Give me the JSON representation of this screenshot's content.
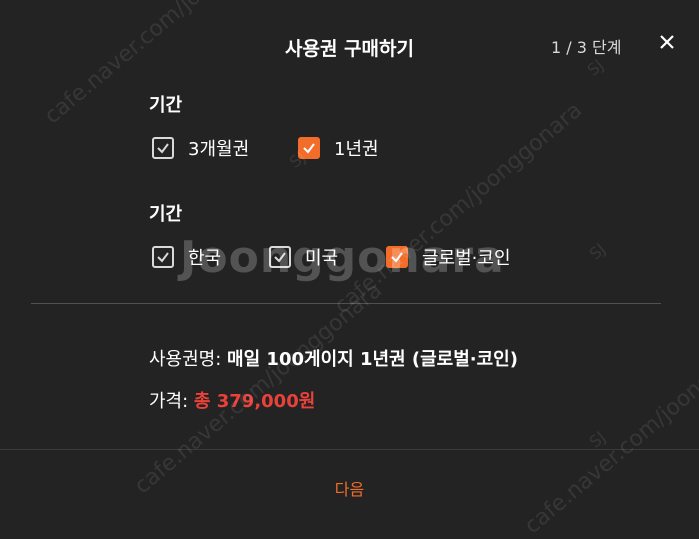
{
  "modal": {
    "title": "사용권 구매하기",
    "step": "1 / 3 단계",
    "close_icon": "close-icon"
  },
  "period": {
    "label": "기간",
    "options": [
      {
        "label": "3개월권",
        "checked": false
      },
      {
        "label": "1년권",
        "checked": true
      }
    ]
  },
  "region": {
    "label": "기간",
    "options": [
      {
        "label": "한국",
        "checked": false
      },
      {
        "label": "미국",
        "checked": false
      },
      {
        "label": "글로벌·코인",
        "checked": true
      }
    ]
  },
  "summary": {
    "name_key": "사용권명:",
    "name_value": "매일 100게이지 1년권 (글로벌·코인)",
    "price_key": "가격:",
    "price_value": "총 379,000원"
  },
  "footer": {
    "next_label": "다음"
  },
  "watermark": {
    "text": "cafe.naver.com/joonggonara",
    "big": "Joonggonara",
    "initials": "SJ"
  },
  "colors": {
    "accent": "#f26d2a",
    "price": "#e8423a",
    "background": "#232323"
  }
}
